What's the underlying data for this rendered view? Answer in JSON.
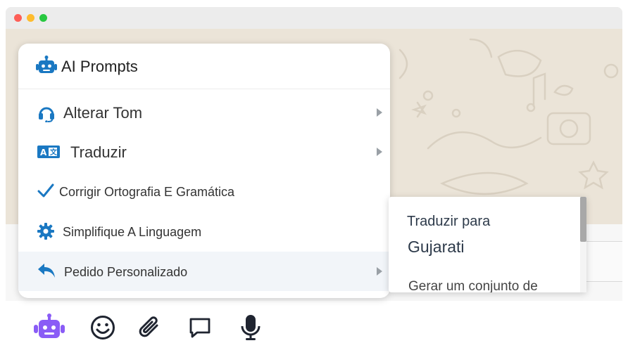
{
  "window": {
    "controls": [
      "close",
      "minimize",
      "maximize"
    ]
  },
  "menu": {
    "header": {
      "icon": "robot-icon",
      "title": "AI Prompts"
    },
    "items": [
      {
        "label": "Alterar Tom",
        "icon": "headset-icon",
        "has_submenu": true
      },
      {
        "label": "Traduzir",
        "icon": "translate-icon",
        "has_submenu": true
      },
      {
        "label": "Corrigir Ortografia E Gramática",
        "icon": "check-icon",
        "has_submenu": false
      },
      {
        "label": "Simplifique A Linguagem",
        "icon": "gear-icon",
        "has_submenu": false
      },
      {
        "label": "Pedido Personalizado",
        "icon": "reply-icon",
        "has_submenu": true
      }
    ]
  },
  "submenu": {
    "title": "Traduzir para",
    "language": "Gujarati",
    "description": "Gerar um conjunto de"
  },
  "toolbar": {
    "icons": [
      "robot-icon",
      "emoji-icon",
      "paperclip-icon",
      "comment-icon",
      "microphone-icon"
    ]
  },
  "colors": {
    "accent_blue": "#1a78c2",
    "robot_purple": "#8a5cf6",
    "wallpaper": "#ebe4d8"
  }
}
